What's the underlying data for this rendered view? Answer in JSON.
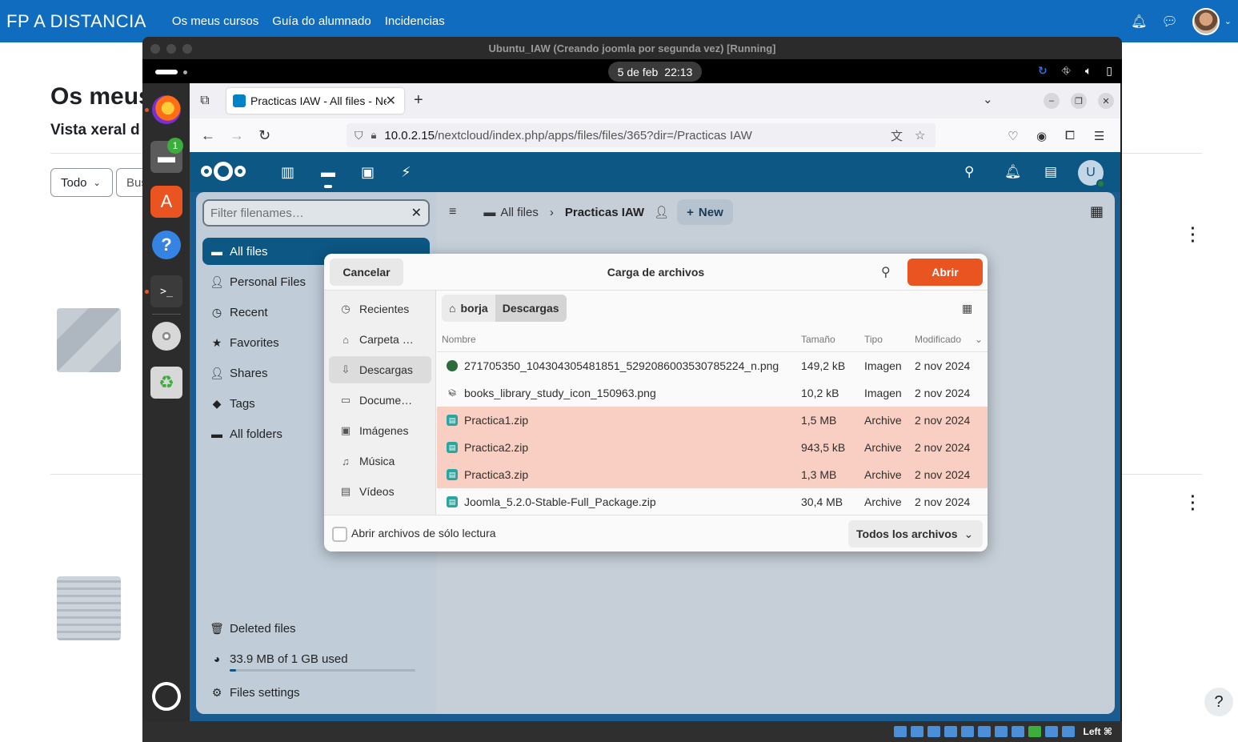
{
  "moodle": {
    "brand": "FP A DISTANCIA",
    "nav": [
      "Os meus cursos",
      "Guía do alumnado",
      "Incidencias"
    ],
    "page_title": "Os meus",
    "subtitle": "Vista xeral d",
    "filter_select": "Todo",
    "search_stub": "Bus",
    "help": "?"
  },
  "vbox": {
    "title": "Ubuntu_IAW (Creando joomla por segunda vez) [Running]",
    "host_key": "Left ⌘"
  },
  "ubuntu": {
    "date": "5 de feb",
    "time": "22:13",
    "files_badge": "1"
  },
  "firefox": {
    "tab_title": "Practicas IAW - All files - Nextcloud",
    "url_host": "10.0.2.15",
    "url_path": "/nextcloud/index.php/apps/files/files/365?dir=/Practicas IAW"
  },
  "nextcloud": {
    "avatar_letter": "U",
    "filter_placeholder": "Filter filenames…",
    "nav": [
      {
        "label": "All files",
        "icon": "folder-icon",
        "active": true
      },
      {
        "label": "Personal Files",
        "icon": "person-icon"
      },
      {
        "label": "Recent",
        "icon": "history-icon"
      },
      {
        "label": "Favorites",
        "icon": "star-icon"
      },
      {
        "label": "Shares",
        "icon": "share-icon"
      },
      {
        "label": "Tags",
        "icon": "tag-icon"
      },
      {
        "label": "All folders",
        "icon": "folders-icon"
      }
    ],
    "deleted_files": "Deleted files",
    "quota": "33.9 MB of 1 GB used",
    "quota_fraction": 0.034,
    "files_settings": "Files settings",
    "breadcrumb": [
      "All files",
      "Practicas IAW"
    ],
    "new_button": "New"
  },
  "dialog": {
    "cancel": "Cancelar",
    "title": "Carga de archivos",
    "open": "Abrir",
    "places": [
      {
        "label": "Recientes",
        "icon": "clock-icon"
      },
      {
        "label": "Carpeta …",
        "icon": "home-icon"
      },
      {
        "label": "Descargas",
        "icon": "download-icon",
        "active": true
      },
      {
        "label": "Docume…",
        "icon": "document-icon"
      },
      {
        "label": "Imágenes",
        "icon": "image-icon"
      },
      {
        "label": "Música",
        "icon": "music-icon"
      },
      {
        "label": "Vídeos",
        "icon": "video-icon"
      }
    ],
    "path": [
      "borja",
      "Descargas"
    ],
    "columns": {
      "name": "Nombre",
      "size": "Tamaño",
      "type": "Tipo",
      "modified": "Modificado"
    },
    "files": [
      {
        "name": "271705350_104304305481851_5292086003530785224_n.png",
        "size": "149,2 kB",
        "type": "Imagen",
        "modified": "2 nov 2024",
        "selected": false,
        "kind": "image"
      },
      {
        "name": "books_library_study_icon_150963.png",
        "size": "10,2 kB",
        "type": "Imagen",
        "modified": "2 nov 2024",
        "selected": false,
        "kind": "image"
      },
      {
        "name": "Practica1.zip",
        "size": "1,5 MB",
        "type": "Archive",
        "modified": "2 nov 2024",
        "selected": true,
        "kind": "zip"
      },
      {
        "name": "Practica2.zip",
        "size": "943,5 kB",
        "type": "Archive",
        "modified": "2 nov 2024",
        "selected": true,
        "kind": "zip"
      },
      {
        "name": "Practica3.zip",
        "size": "1,3 MB",
        "type": "Archive",
        "modified": "2 nov 2024",
        "selected": true,
        "kind": "zip"
      },
      {
        "name": "Joomla_5.2.0-Stable-Full_Package.zip",
        "size": "30,4 MB",
        "type": "Archive",
        "modified": "2 nov 2024",
        "selected": false,
        "kind": "zip"
      }
    ],
    "readonly_label": "Abrir archivos de sólo lectura",
    "filter": "Todos los archivos"
  },
  "colors": {
    "moodle_blue": "#0f6cbf",
    "nextcloud_blue": "#0c5784",
    "ubuntu_orange": "#e95420",
    "selection": "#f8cfc2"
  }
}
